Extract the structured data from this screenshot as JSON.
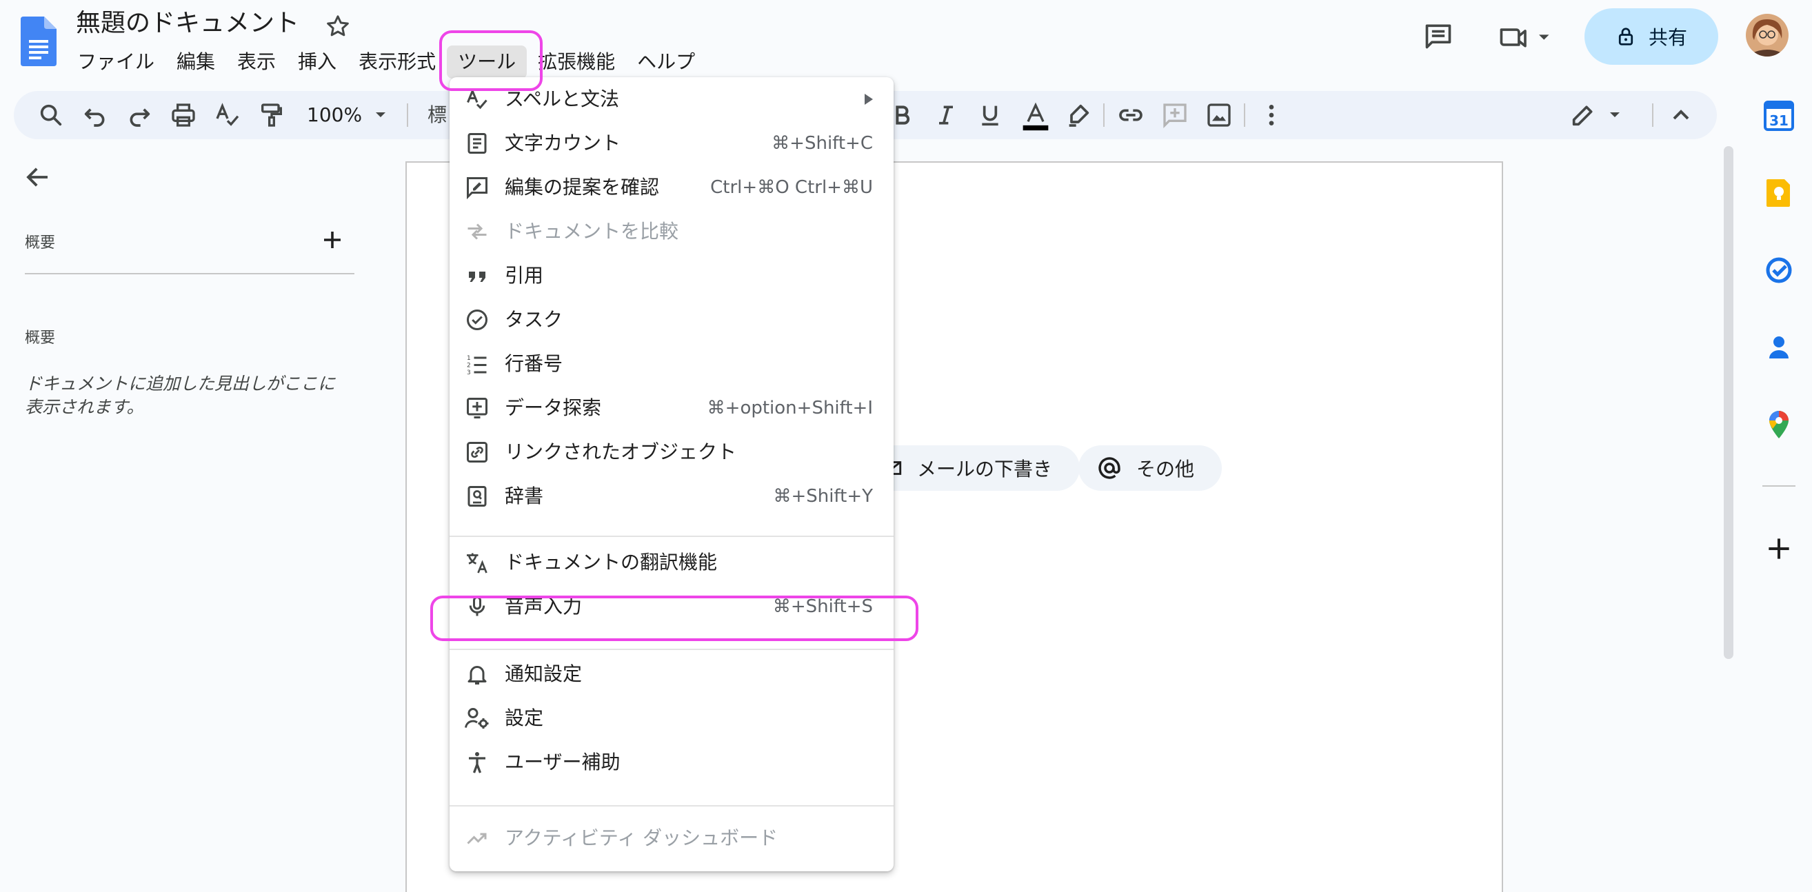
{
  "colors": {
    "accent": "#0b57d0",
    "share_bg": "#c2e7ff",
    "highlight": "#ee45e8",
    "toolbar_bg": "#edf2fa"
  },
  "header": {
    "title": "無題のドキュメント",
    "menu": [
      "ファイル",
      "編集",
      "表示",
      "挿入",
      "表示形式",
      "ツール",
      "拡張機能",
      "ヘルプ"
    ],
    "active_menu": "ツール",
    "share_label": "共有"
  },
  "toolbar": {
    "zoom": "100%",
    "style_partial": "標"
  },
  "outline": {
    "section_label": "概要",
    "summary_label": "概要",
    "hint": "ドキュメントに追加した見出しがここに表示されます。"
  },
  "page": {
    "chips": [
      {
        "label": "メールの下書き",
        "icon": "mail-draft-icon"
      },
      {
        "label": "その他",
        "icon": "at-icon"
      }
    ]
  },
  "tools_menu": {
    "items": [
      {
        "label": "スペルと文法",
        "shortcut": "",
        "icon": "spellcheck-icon",
        "submenu": true,
        "disabled": false
      },
      {
        "label": "文字カウント",
        "shortcut": "⌘+Shift+C",
        "icon": "word-count-icon",
        "disabled": false
      },
      {
        "label": "編集の提案を確認",
        "shortcut": "Ctrl+⌘O Ctrl+⌘U",
        "icon": "review-edits-icon",
        "disabled": false
      },
      {
        "label": "ドキュメントを比較",
        "shortcut": "",
        "icon": "compare-icon",
        "disabled": true
      },
      {
        "label": "引用",
        "shortcut": "",
        "icon": "quote-icon",
        "disabled": false
      },
      {
        "label": "タスク",
        "shortcut": "",
        "icon": "task-icon",
        "disabled": false
      },
      {
        "label": "行番号",
        "shortcut": "",
        "icon": "line-numbers-icon",
        "disabled": false
      },
      {
        "label": "データ探索",
        "shortcut": "⌘+option+Shift+I",
        "icon": "explore-icon",
        "disabled": false
      },
      {
        "label": "リンクされたオブジェクト",
        "shortcut": "",
        "icon": "linked-objects-icon",
        "disabled": false
      },
      {
        "label": "辞書",
        "shortcut": "⌘+Shift+Y",
        "icon": "dictionary-icon",
        "disabled": false
      },
      {
        "label": "ドキュメントの翻訳機能",
        "shortcut": "",
        "icon": "translate-icon",
        "disabled": false
      },
      {
        "label": "音声入力",
        "shortcut": "⌘+Shift+S",
        "icon": "microphone-icon",
        "disabled": false
      },
      {
        "label": "通知設定",
        "shortcut": "",
        "icon": "bell-icon",
        "disabled": false
      },
      {
        "label": "設定",
        "shortcut": "",
        "icon": "settings-icon",
        "disabled": false
      },
      {
        "label": "ユーザー補助",
        "shortcut": "",
        "icon": "accessibility-icon",
        "disabled": false
      },
      {
        "label": "アクティビティ ダッシュボード",
        "shortcut": "",
        "icon": "activity-icon",
        "disabled": true
      }
    ]
  },
  "side_panel": {
    "calendar_day": "31"
  }
}
